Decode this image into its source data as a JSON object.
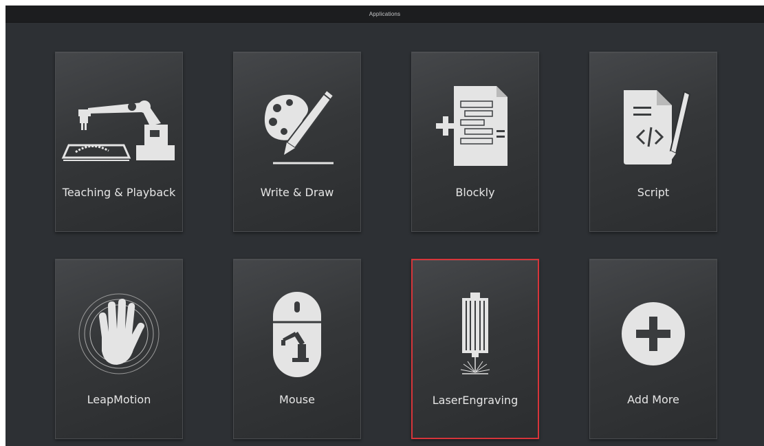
{
  "window": {
    "title": "Applications"
  },
  "tiles": [
    {
      "label": "Teaching & Playback",
      "icon": "robot-arm-icon"
    },
    {
      "label": "Write & Draw",
      "icon": "palette-pencil-icon"
    },
    {
      "label": "Blockly",
      "icon": "blockly-document-icon"
    },
    {
      "label": "Script",
      "icon": "script-document-icon"
    },
    {
      "label": "LeapMotion",
      "icon": "hand-icon"
    },
    {
      "label": "Mouse",
      "icon": "mouse-icon"
    },
    {
      "label": "LaserEngraving",
      "icon": "laser-icon"
    },
    {
      "label": "Add More",
      "icon": "plus-circle-icon"
    }
  ],
  "selected_tile": "LaserEngraving",
  "colors": {
    "background": "#2d3034",
    "selection": "#d7353a",
    "icon": "#e4e4e4"
  }
}
